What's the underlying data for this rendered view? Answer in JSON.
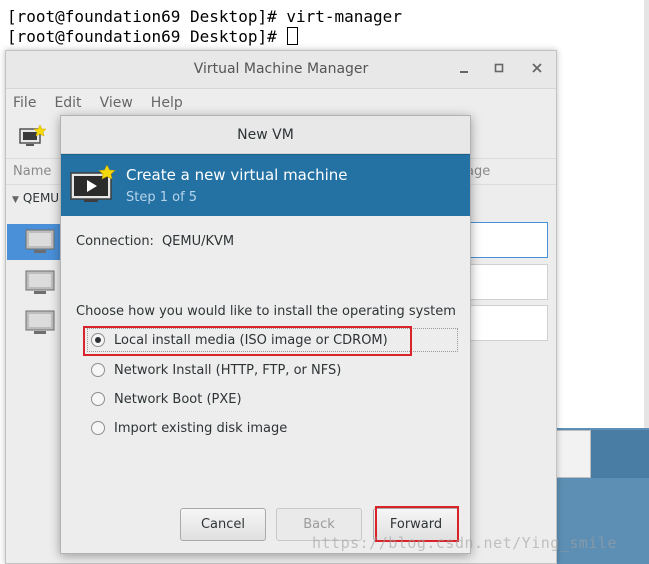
{
  "terminal": {
    "line1": "[root@foundation69 Desktop]# virt-manager",
    "line2": "[root@foundation69 Desktop]# "
  },
  "vmm": {
    "title": "Virtual Machine Manager",
    "menu": [
      "File",
      "Edit",
      "View",
      "Help"
    ],
    "column_name": "Name",
    "column_usage": "age",
    "group_label": "QEMU"
  },
  "dialog": {
    "title": "New VM",
    "banner_title": "Create a new virtual machine",
    "banner_step": "Step 1 of 5",
    "connection_label": "Connection:",
    "connection_value": "QEMU/KVM",
    "choose_label": "Choose how you would like to install the operating system",
    "options": [
      {
        "label": "Local install media (ISO image or CDROM)",
        "checked": true
      },
      {
        "label": "Network Install (HTTP, FTP, or NFS)",
        "checked": false
      },
      {
        "label": "Network Boot (PXE)",
        "checked": false
      },
      {
        "label": "Import existing disk image",
        "checked": false
      }
    ],
    "buttons": {
      "cancel": "Cancel",
      "back": "Back",
      "forward": "Forward"
    }
  },
  "watermark": "https://blog.csdn.net/Ying_smile",
  "colors": {
    "banner": "#2472a4",
    "highlight": "#d9232a"
  }
}
